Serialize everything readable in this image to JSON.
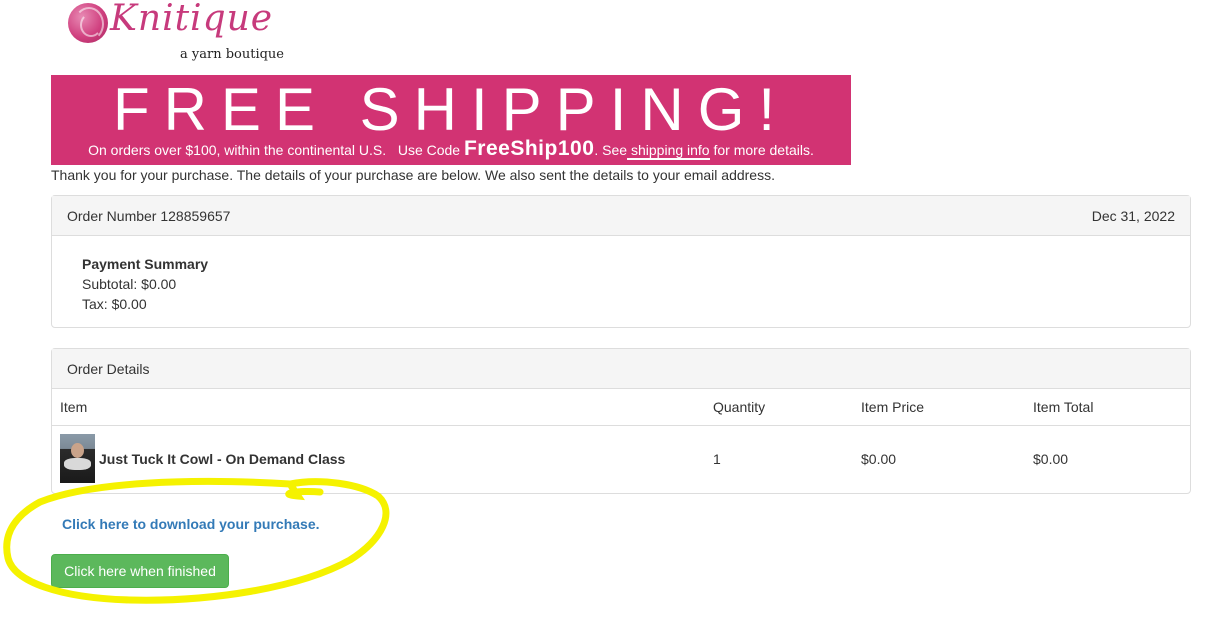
{
  "logo": {
    "brand": "Knitique",
    "tagline": "a yarn boutique"
  },
  "banner": {
    "headline": "FREE SHIPPING!",
    "sub_prefix": "On orders over $100, within the continental U.S.   Use Code ",
    "code": "FreeShip100",
    "sub_mid": ". See",
    "link_text": " shipping info",
    "sub_suffix": " for more details.",
    "color": "#d23373"
  },
  "thanks_message": "Thank you for your purchase. The details of your purchase are below. We also sent the details to your email address.",
  "order": {
    "number_label": "Order Number 128859657",
    "date": "Dec 31, 2022"
  },
  "payment_summary": {
    "title": "Payment Summary",
    "subtotal": "Subtotal: $0.00",
    "tax": "Tax: $0.00"
  },
  "order_details": {
    "heading": "Order Details",
    "columns": [
      "Item",
      "Quantity",
      "Item Price",
      "Item Total"
    ],
    "rows": [
      {
        "item": "Just Tuck It Cowl - On Demand Class",
        "quantity": "1",
        "price": "$0.00",
        "total": "$0.00"
      }
    ]
  },
  "download_link": "Click here to download your purchase.",
  "finish_button": "Click here when finished",
  "colors": {
    "link": "#337ab7",
    "button": "#5cb85c",
    "highlight": "#f5f200"
  }
}
